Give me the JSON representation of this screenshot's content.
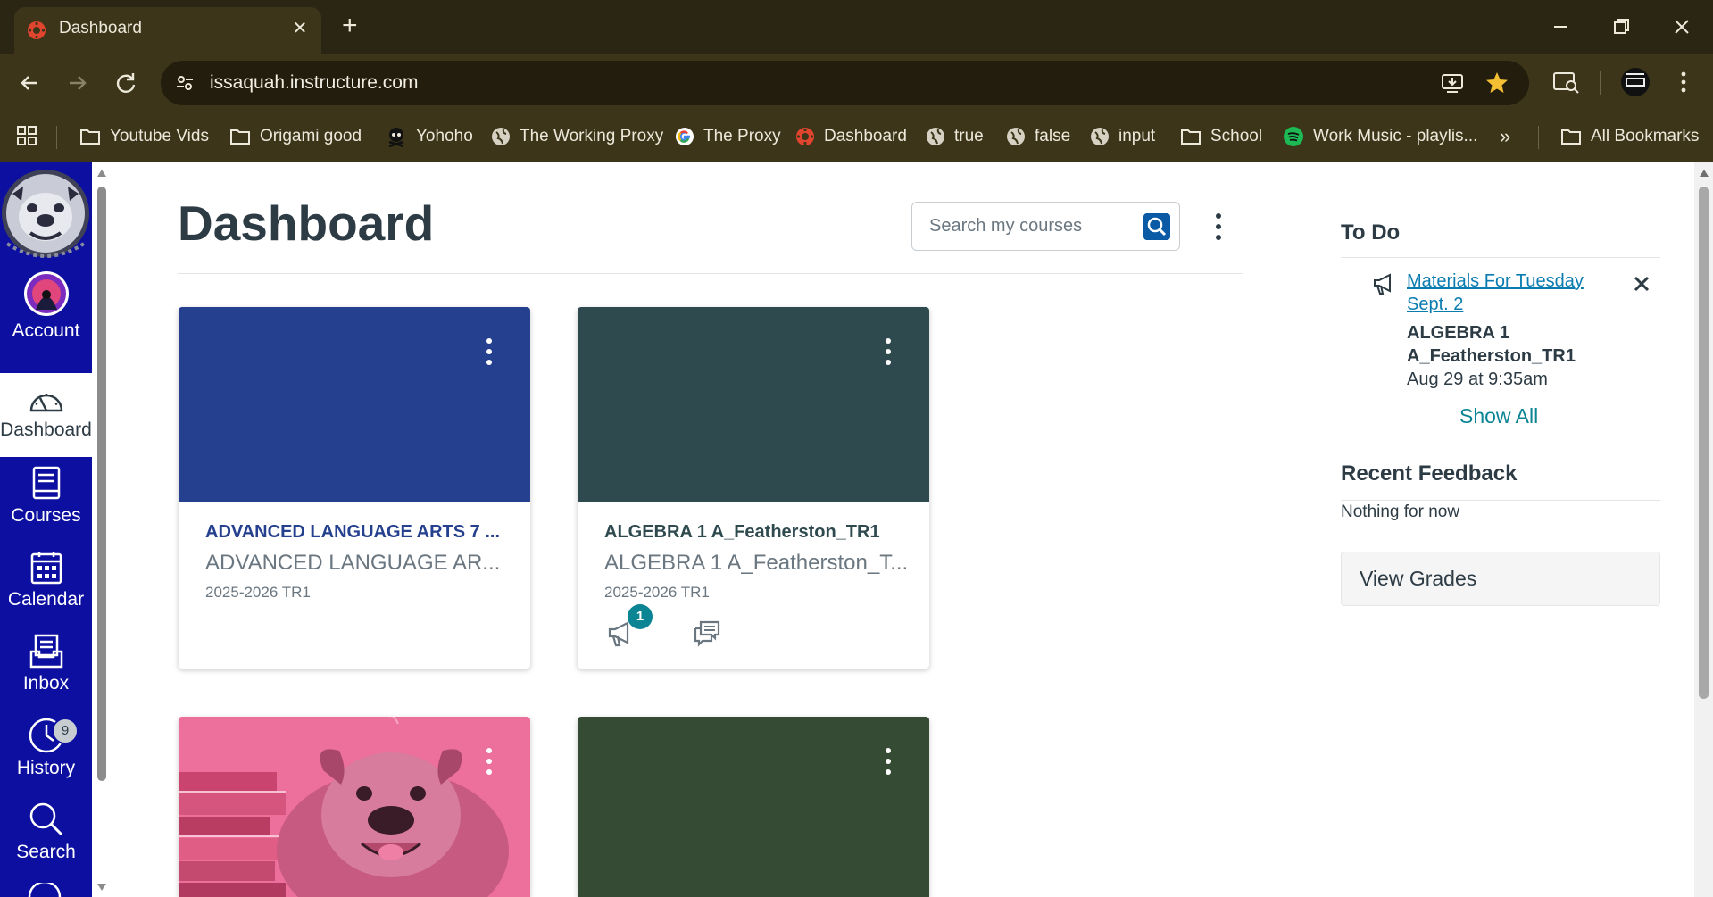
{
  "browser": {
    "tab_title": "Dashboard",
    "url": "issaquah.instructure.com",
    "bookmarks": [
      {
        "label": "Youtube Vids",
        "icon": "folder-icon"
      },
      {
        "label": "Origami good",
        "icon": "folder-icon"
      },
      {
        "label": "Yohoho",
        "icon": "skull-icon"
      },
      {
        "label": "The Working Proxy",
        "icon": "globe-icon"
      },
      {
        "label": "The Proxy",
        "icon": "google-icon"
      },
      {
        "label": "Dashboard",
        "icon": "canvas-icon"
      },
      {
        "label": "true",
        "icon": "globe-icon"
      },
      {
        "label": "false",
        "icon": "globe-icon"
      },
      {
        "label": "input",
        "icon": "globe-icon"
      },
      {
        "label": "School",
        "icon": "folder-icon"
      },
      {
        "label": "Work Music - playlis...",
        "icon": "spotify-icon"
      }
    ],
    "more_bookmarks": "»",
    "all_bookmarks": "All Bookmarks"
  },
  "global_nav": {
    "items": [
      {
        "label": "Account",
        "icon": "avatar-icon"
      },
      {
        "label": "Dashboard",
        "icon": "dashboard-icon"
      },
      {
        "label": "Courses",
        "icon": "courses-icon"
      },
      {
        "label": "Calendar",
        "icon": "calendar-icon"
      },
      {
        "label": "Inbox",
        "icon": "inbox-icon"
      },
      {
        "label": "History",
        "icon": "clock-icon"
      },
      {
        "label": "Search",
        "icon": "search-icon"
      }
    ],
    "help_badge": "9"
  },
  "dashboard": {
    "title": "Dashboard",
    "search_placeholder": "Search my courses"
  },
  "cards": [
    {
      "title": "ADVANCED LANGUAGE ARTS 7 ...",
      "subtitle": "ADVANCED LANGUAGE AR...",
      "term": "2025-2026 TR1",
      "color": "#25408f",
      "title_color": "#25408f"
    },
    {
      "title": "ALGEBRA 1 A_Featherston_TR1",
      "subtitle": "ALGEBRA 1 A_Featherston_T...",
      "term": "2025-2026 TR1",
      "color": "#2f4a4f",
      "title_color": "#2f4a4f",
      "announcement_count": "1"
    },
    {
      "color": "#ec6f9c"
    },
    {
      "color": "#354b34"
    }
  ],
  "todo": {
    "heading": "To Do",
    "item_title": "Materials For Tuesday Sept. 2",
    "item_course": "ALGEBRA 1 A_Featherston_TR1",
    "item_date": "Aug 29 at 9:35am",
    "show_all": "Show All"
  },
  "feedback": {
    "heading": "Recent Feedback",
    "empty": "Nothing for now"
  },
  "view_grades": "View Grades"
}
